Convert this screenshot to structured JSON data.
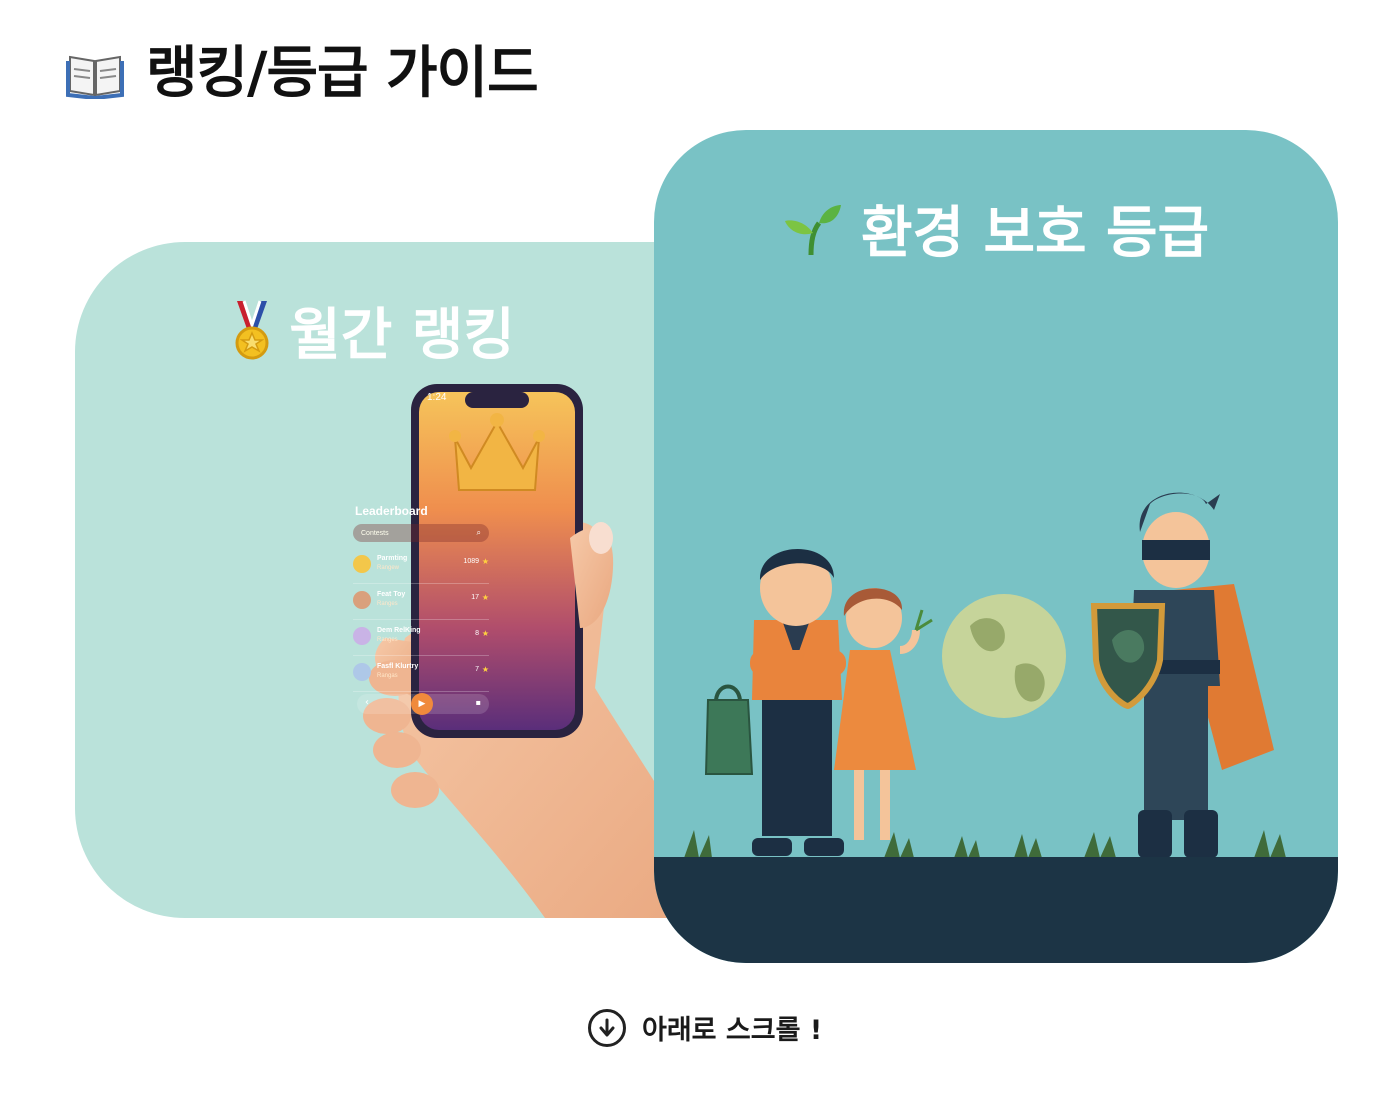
{
  "header": {
    "title": "랭킹/등급 가이드",
    "icon": "open-book-icon"
  },
  "cards": {
    "monthly": {
      "title": "월간 랭킹",
      "icon": "medal-icon",
      "bg": "#bae2da",
      "phone": {
        "time": "1:24",
        "heading": "Leaderboard",
        "search_placeholder": "Contests",
        "entries": [
          {
            "name": "Parmting",
            "sub": "Rangew",
            "score": "1089"
          },
          {
            "name": "Feat Toy",
            "sub": "Ranges",
            "score": "17"
          },
          {
            "name": "Dem RelKing",
            "sub": "Ranges",
            "score": "8"
          },
          {
            "name": "Fasfl Klurtry",
            "sub": "Rangas",
            "score": "7"
          }
        ]
      }
    },
    "eco": {
      "title": "환경 보호 등급",
      "icon": "seedling-icon",
      "bg": "#79c2c5"
    }
  },
  "scroll_hint": {
    "label": "아래로 스크롤 !",
    "icon": "arrow-down-circle-icon"
  }
}
